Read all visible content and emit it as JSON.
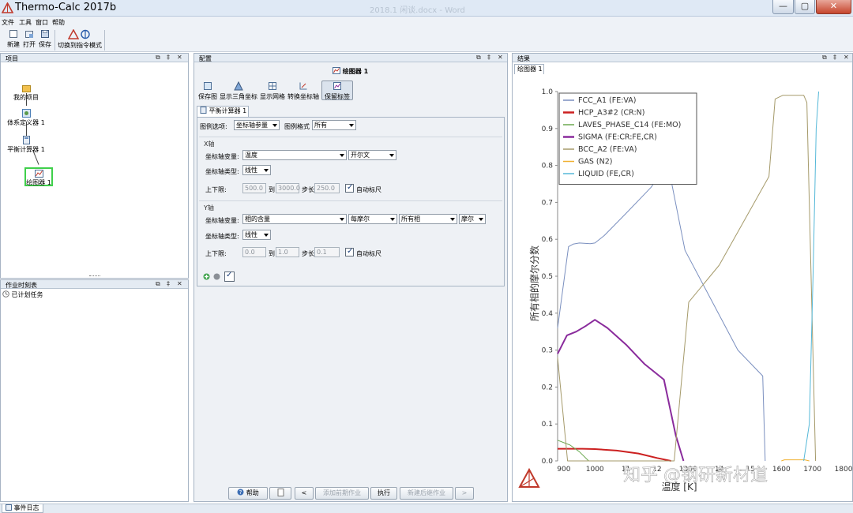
{
  "window": {
    "title": "Thermo-Calc 2017b",
    "background_title": "2018.1 闲谈.docx - Word",
    "controls": {
      "minimize": "—",
      "maximize": "▢",
      "close": "✕"
    }
  },
  "menu": [
    "文件",
    "工具",
    "窗口",
    "帮助"
  ],
  "toolbar": {
    "new_label": "新建",
    "open_label": "打开",
    "save_label": "保存",
    "console_label": "切换到指令模式"
  },
  "project_panel": {
    "title": "项目",
    "controls": [
      "⧉",
      "‡",
      "✕"
    ],
    "nodes": {
      "project": "我的项目",
      "system": "体系定义器 1",
      "equilibrium": "平衡计算器 1",
      "plot": "绘图器 1"
    }
  },
  "schedule_panel": {
    "title": "作业时刻表",
    "controls": [
      "⧉",
      "‡",
      "✕"
    ],
    "item": "已计划任务"
  },
  "config_panel": {
    "title": "配置",
    "controls": [
      "⧉",
      "‡",
      "✕"
    ],
    "plot_title": "绘图器 1",
    "actions": {
      "save_plot": "保存图",
      "triangle": "显示三角坐标",
      "grid": "显示网格",
      "swap_axes": "转换坐标轴",
      "keep_labels": "保留标签"
    },
    "tab": "平衡计算器 1",
    "legend_option_label": "图例选项:",
    "legend_option_value": "坐标轴参量",
    "legend_style_label": "图例格式",
    "legend_style_value": "所有",
    "x_axis": {
      "title": "X轴",
      "variable_label": "坐标轴变量:",
      "variable_value": "温度",
      "unit_value": "开尔文",
      "type_label": "坐标轴类型:",
      "type_value": "线性",
      "limits_label": "上下限:",
      "min": "500.0",
      "to_label": "到",
      "max": "3000.0",
      "step_label": "步长",
      "step": "250.0",
      "auto_label": "自动标尺"
    },
    "y_axis": {
      "title": "Y轴",
      "variable_label": "坐标轴变量:",
      "variable_value": "相的含量",
      "basis_value": "每摩尔",
      "phase_value": "所有相",
      "unit_value": "摩尔",
      "type_label": "坐标轴类型:",
      "type_value": "线性",
      "limits_label": "上下限:",
      "min": "0.0",
      "to_label": "到",
      "max": "1.0",
      "step_label": "步长",
      "step": "0.1",
      "auto_label": "自动标尺"
    },
    "bottom_buttons": {
      "help": "帮助",
      "prev": "<",
      "add_prev": "添加前期作业",
      "run": "执行",
      "add_next": "新建后继作业",
      "next": ">"
    }
  },
  "results_panel": {
    "title": "结果",
    "controls": [
      "⧉",
      "‡",
      "✕"
    ],
    "tab": "绘图器 1"
  },
  "status_bar": {
    "tab": "事件日志"
  },
  "watermark": "知乎 @钢研新材道",
  "chart_data": {
    "type": "line",
    "xlabel": "温度 [K]",
    "ylabel": "所有相的摩尔分数",
    "xlim": [
      880,
      1800
    ],
    "ylim": [
      0,
      1.0
    ],
    "x_ticks": [
      900,
      1000,
      1100,
      1200,
      1300,
      1400,
      1500,
      1600,
      1700,
      1800
    ],
    "x_tick_labels": [
      "900",
      "1000",
      "11",
      "12",
      "1300",
      "14",
      "15",
      "1600",
      "1700",
      "1800"
    ],
    "y_ticks": [
      0,
      0.1,
      0.2,
      0.3,
      0.4,
      0.5,
      0.6,
      0.7,
      0.8,
      0.9,
      1.0
    ],
    "y_tick_labels": [
      "0.0",
      "0.1",
      "0.2",
      "0.3",
      "0.4",
      "0.5",
      "0.6",
      "0.7",
      "0.8",
      "0.9",
      "1.0"
    ],
    "grid": false,
    "legend_position": "top-left",
    "series": [
      {
        "name": "FCC_A1  (FE:VA)",
        "color": "#7a8fbf",
        "width": 1,
        "points": [
          [
            880,
            0.36
          ],
          [
            915,
            0.58
          ],
          [
            930,
            0.587
          ],
          [
            950,
            0.59
          ],
          [
            985,
            0.588
          ],
          [
            1000,
            0.59
          ],
          [
            1030,
            0.61
          ],
          [
            1100,
            0.67
          ],
          [
            1180,
            0.74
          ],
          [
            1215,
            0.78
          ],
          [
            1238,
            0.79
          ],
          [
            1290,
            0.57
          ],
          [
            1460,
            0.3
          ],
          [
            1540,
            0.23
          ],
          [
            1548,
            0.0
          ]
        ]
      },
      {
        "name": "HCP_A3#2  (CR:N)",
        "color": "#cc2020",
        "width": 2,
        "points": [
          [
            880,
            0.033
          ],
          [
            920,
            0.033
          ],
          [
            960,
            0.033
          ],
          [
            1000,
            0.032
          ],
          [
            1070,
            0.028
          ],
          [
            1140,
            0.02
          ],
          [
            1200,
            0.008
          ],
          [
            1245,
            0.0
          ]
        ]
      },
      {
        "name": "LAVES_PHASE_C14  (FE:MO)",
        "color": "#6aa84f",
        "width": 1,
        "points": [
          [
            880,
            0.056
          ],
          [
            920,
            0.043
          ],
          [
            950,
            0.025
          ],
          [
            980,
            0.0
          ]
        ]
      },
      {
        "name": "SIGMA  (FE:CR:FE,CR)",
        "color": "#8a2b9c",
        "width": 2,
        "points": [
          [
            880,
            0.29
          ],
          [
            910,
            0.34
          ],
          [
            940,
            0.35
          ],
          [
            970,
            0.365
          ],
          [
            1000,
            0.382
          ],
          [
            1040,
            0.36
          ],
          [
            1100,
            0.315
          ],
          [
            1160,
            0.262
          ],
          [
            1222,
            0.22
          ],
          [
            1260,
            0.07
          ],
          [
            1285,
            0.0
          ]
        ]
      },
      {
        "name": "BCC_A2  (FE:VA)",
        "color": "#a59a6a",
        "width": 1,
        "points": [
          [
            880,
            0.28
          ],
          [
            912,
            0.0
          ],
          [
            1255,
            0.0
          ],
          [
            1302,
            0.43
          ],
          [
            1400,
            0.53
          ],
          [
            1560,
            0.77
          ],
          [
            1580,
            0.98
          ],
          [
            1605,
            0.99
          ],
          [
            1672,
            0.99
          ],
          [
            1682,
            0.97
          ],
          [
            1710,
            0.0
          ]
        ]
      },
      {
        "name": "GAS  (N2)",
        "color": "#f0b030",
        "width": 1,
        "points": [
          [
            1600,
            0.0
          ],
          [
            1610,
            0.003
          ],
          [
            1625,
            0.003
          ],
          [
            1675,
            0.003
          ],
          [
            1690,
            0.0
          ]
        ]
      },
      {
        "name": "LIQUID  (FE,CR)",
        "color": "#55b8d8",
        "width": 1,
        "points": [
          [
            1672,
            0.0
          ],
          [
            1690,
            0.1
          ],
          [
            1702,
            0.5
          ],
          [
            1712,
            0.9
          ],
          [
            1720,
            1.0
          ]
        ]
      }
    ]
  }
}
